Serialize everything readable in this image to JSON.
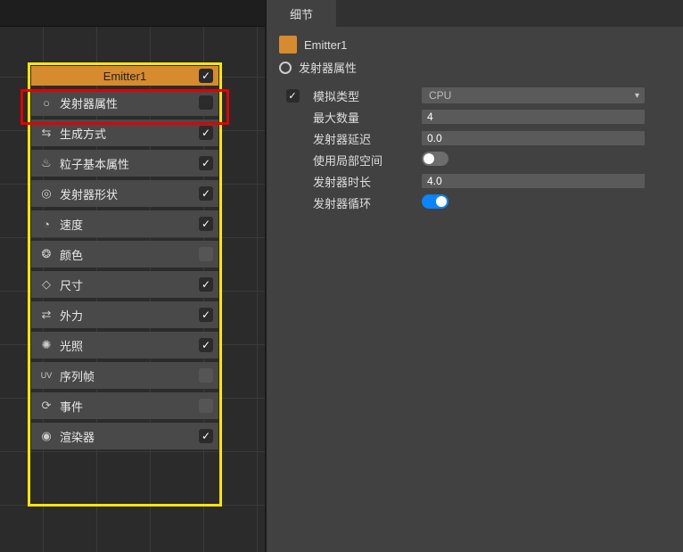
{
  "left": {
    "emitter_name": "Emitter1",
    "props": [
      {
        "icon": "○",
        "label": "发射器属性",
        "checked": false,
        "unchecked_style": false
      },
      {
        "icon": "⇆",
        "label": "生成方式",
        "checked": true
      },
      {
        "icon": "♨",
        "label": "粒子基本属性",
        "checked": true
      },
      {
        "icon": "◎",
        "label": "发射器形状",
        "checked": true
      },
      {
        "icon": "◔",
        "label": "速度",
        "checked": true
      },
      {
        "icon": "❂",
        "label": "颜色",
        "checked": false,
        "off_grey": true
      },
      {
        "icon": "◇",
        "label": "尺寸",
        "checked": true
      },
      {
        "icon": "⇄",
        "label": "外力",
        "checked": true
      },
      {
        "icon": "✺",
        "label": "光照",
        "checked": true
      },
      {
        "icon": "UV",
        "label": "序列帧",
        "checked": false,
        "off_grey": true
      },
      {
        "icon": "⟳",
        "label": "事件",
        "checked": false,
        "off_grey": true
      },
      {
        "icon": "◉",
        "label": "渲染器",
        "checked": true
      }
    ]
  },
  "right": {
    "tab_label": "细节",
    "emitter_label": "Emitter1",
    "section_label": "发射器属性",
    "rows": {
      "sim_type": {
        "label": "模拟类型",
        "value": "CPU"
      },
      "max_count": {
        "label": "最大数量",
        "value": "4"
      },
      "delay": {
        "label": "发射器延迟",
        "value": "0.0"
      },
      "local_space": {
        "label": "使用局部空间",
        "value": false
      },
      "duration": {
        "label": "发射器时长",
        "value": "4.0"
      },
      "loop": {
        "label": "发射器循环",
        "value": true
      }
    }
  }
}
